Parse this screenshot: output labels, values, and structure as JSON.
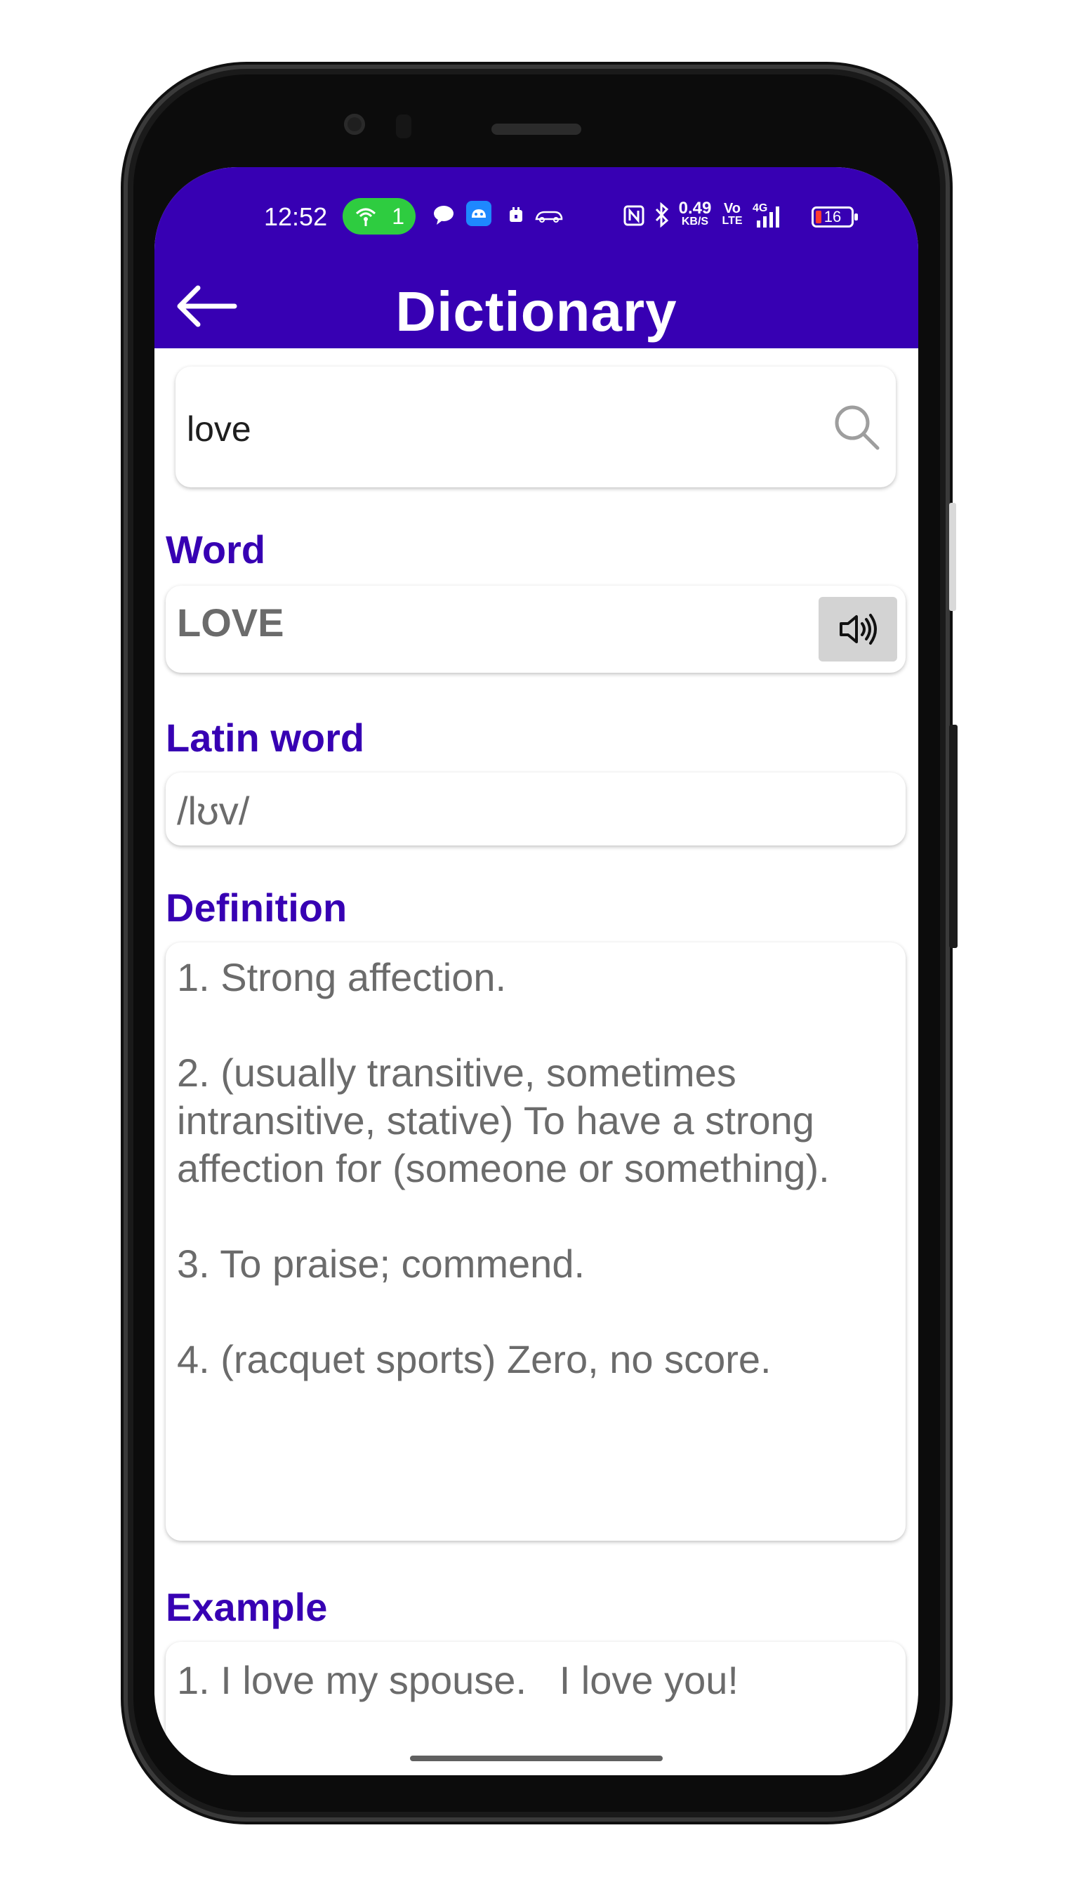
{
  "status_bar": {
    "time": "12:52",
    "hotspot_count": "1",
    "net_speed_value": "0.49",
    "net_speed_unit": "KB/S",
    "volte_top": "Vo",
    "volte_bottom": "LTE",
    "signal_label": "4G",
    "battery_level": "16",
    "colors": {
      "bar": "#3700b3",
      "hotspot": "#2ecc40",
      "battery_low": "#ff3b30"
    }
  },
  "appbar": {
    "title": "Dictionary",
    "back_icon": "arrow-left-icon"
  },
  "search": {
    "value": "love",
    "icon": "search-icon"
  },
  "sections": {
    "word_label": "Word",
    "word_value": "LOVE",
    "speaker_icon": "speaker-icon",
    "latin_label": "Latin word",
    "latin_value": "/lʊv/",
    "definition_label": "Definition",
    "definition_text": "1. Strong affection.\n\n2. (usually transitive, sometimes intransitive, stative) To have a strong affection for (someone or something).\n\n3. To praise; commend.\n\n4. (racquet sports) Zero, no score.",
    "example_label": "Example",
    "example_text": "1. I love my spouse.   I love you!"
  },
  "theme": {
    "primary": "#3700b3",
    "text_gray": "#6b6b6b",
    "button_gray": "#d3d3d3"
  }
}
